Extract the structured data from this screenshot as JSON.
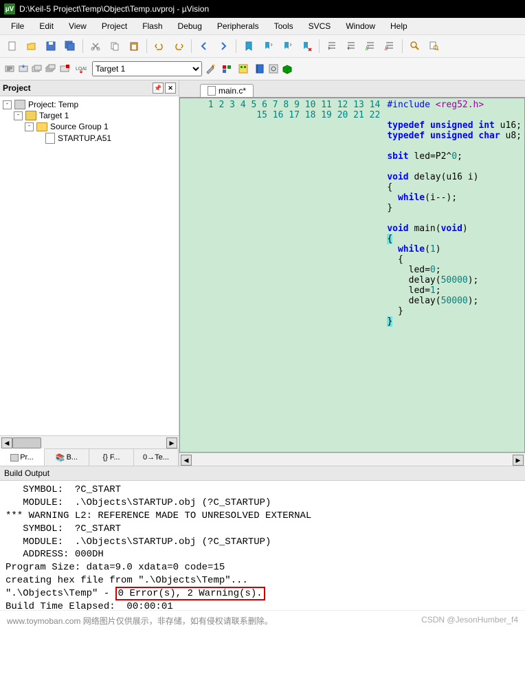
{
  "window": {
    "title": "D:\\Keil-5 Project\\Temp\\Object\\Temp.uvproj - µVision"
  },
  "menu": [
    "File",
    "Edit",
    "View",
    "Project",
    "Flash",
    "Debug",
    "Peripherals",
    "Tools",
    "SVCS",
    "Window",
    "Help"
  ],
  "target_selector": {
    "value": "Target 1"
  },
  "project_panel": {
    "title": "Project",
    "root": "Project: Temp",
    "target": "Target 1",
    "group": "Source Group 1",
    "file": "STARTUP.A51",
    "tabs": [
      "Pr...",
      "B...",
      "{} F...",
      "0→Te..."
    ]
  },
  "editor": {
    "filename": "main.c*",
    "code_lines": [
      {
        "n": 1,
        "seg": [
          [
            "pp",
            "#include "
          ],
          [
            "inc",
            "<reg52.h>"
          ]
        ]
      },
      {
        "n": 2,
        "seg": []
      },
      {
        "n": 3,
        "seg": [
          [
            "kw",
            "typedef "
          ],
          [
            "kw",
            "unsigned int"
          ],
          [
            "id",
            " u16"
          ],
          [
            "op",
            ";"
          ]
        ]
      },
      {
        "n": 4,
        "seg": [
          [
            "kw",
            "typedef "
          ],
          [
            "kw",
            "unsigned char"
          ],
          [
            "id",
            " u8"
          ],
          [
            "op",
            ";"
          ]
        ]
      },
      {
        "n": 5,
        "seg": []
      },
      {
        "n": 6,
        "seg": [
          [
            "kw",
            "sbit"
          ],
          [
            "id",
            " led"
          ],
          [
            "op",
            "="
          ],
          [
            "id",
            "P2"
          ],
          [
            "op",
            "^"
          ],
          [
            "num",
            "0"
          ],
          [
            "op",
            ";"
          ]
        ]
      },
      {
        "n": 7,
        "seg": []
      },
      {
        "n": 8,
        "seg": [
          [
            "kw",
            "void"
          ],
          [
            "id",
            " delay"
          ],
          [
            "op",
            "("
          ],
          [
            "id",
            "u16 i"
          ],
          [
            "op",
            ")"
          ]
        ]
      },
      {
        "n": 9,
        "seg": [
          [
            "op",
            "{"
          ]
        ]
      },
      {
        "n": 10,
        "seg": [
          [
            "id",
            "  "
          ],
          [
            "kw",
            "while"
          ],
          [
            "op",
            "("
          ],
          [
            "id",
            "i"
          ],
          [
            "op",
            "--);"
          ]
        ]
      },
      {
        "n": 11,
        "seg": [
          [
            "op",
            "}"
          ]
        ]
      },
      {
        "n": 12,
        "seg": []
      },
      {
        "n": 13,
        "seg": [
          [
            "kw",
            "void"
          ],
          [
            "id",
            " main"
          ],
          [
            "op",
            "("
          ],
          [
            "kw",
            "void"
          ],
          [
            "op",
            ")"
          ]
        ]
      },
      {
        "n": 14,
        "seg": [
          [
            "br",
            "{"
          ]
        ]
      },
      {
        "n": 15,
        "seg": [
          [
            "id",
            "  "
          ],
          [
            "kw",
            "while"
          ],
          [
            "op",
            "("
          ],
          [
            "num",
            "1"
          ],
          [
            "op",
            ")"
          ]
        ]
      },
      {
        "n": 16,
        "seg": [
          [
            "id",
            "  "
          ],
          [
            "op",
            "{"
          ]
        ]
      },
      {
        "n": 17,
        "seg": [
          [
            "id",
            "    led"
          ],
          [
            "op",
            "="
          ],
          [
            "num",
            "0"
          ],
          [
            "op",
            ";"
          ]
        ]
      },
      {
        "n": 18,
        "seg": [
          [
            "id",
            "    delay"
          ],
          [
            "op",
            "("
          ],
          [
            "num",
            "50000"
          ],
          [
            "op",
            ");"
          ]
        ]
      },
      {
        "n": 19,
        "seg": [
          [
            "id",
            "    led"
          ],
          [
            "op",
            "="
          ],
          [
            "num",
            "1"
          ],
          [
            "op",
            ";"
          ]
        ]
      },
      {
        "n": 20,
        "seg": [
          [
            "id",
            "    delay"
          ],
          [
            "op",
            "("
          ],
          [
            "num",
            "50000"
          ],
          [
            "op",
            ");"
          ]
        ]
      },
      {
        "n": 21,
        "seg": [
          [
            "id",
            "  "
          ],
          [
            "op",
            "}"
          ]
        ]
      },
      {
        "n": 22,
        "seg": [
          [
            "br",
            "}"
          ]
        ]
      }
    ]
  },
  "build": {
    "title": "Build Output",
    "lines_pre": [
      "   SYMBOL:  ?C_START",
      "   MODULE:  .\\Objects\\STARTUP.obj (?C_STARTUP)",
      "*** WARNING L2: REFERENCE MADE TO UNRESOLVED EXTERNAL",
      "   SYMBOL:  ?C_START",
      "   MODULE:  .\\Objects\\STARTUP.obj (?C_STARTUP)",
      "   ADDRESS: 000DH",
      "Program Size: data=9.0 xdata=0 code=15",
      "creating hex file from \".\\Objects\\Temp\"..."
    ],
    "result_prefix": "\".\\Objects\\Temp\" - ",
    "result_box": "0 Error(s), 2 Warning(s).",
    "time": "Build Time Elapsed:  00:00:01"
  },
  "footer": {
    "left": "www.toymoban.com 网络图片仅供展示，非存储，如有侵权请联系删除。",
    "right": "CSDN @JesonHumber_f4"
  }
}
